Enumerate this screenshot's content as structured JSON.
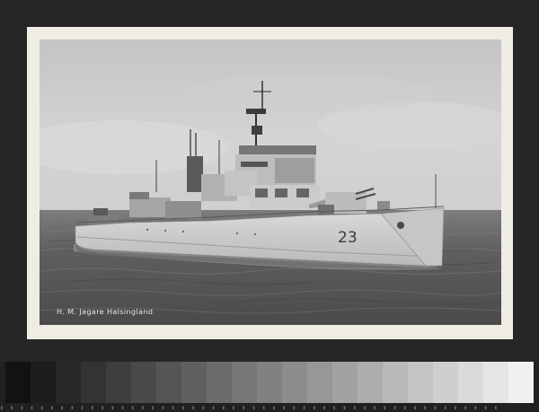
{
  "caption": "H. M. Jagare Halsingland",
  "hull_number": "23",
  "colors": {
    "sky_top": "#c9c9c9",
    "sky_bottom": "#d8d8d6",
    "sea": "#5a5a5a",
    "hull": "#d2d2d2",
    "border": "#efece4",
    "background": "#262626"
  },
  "gray_scale_steps": 21
}
